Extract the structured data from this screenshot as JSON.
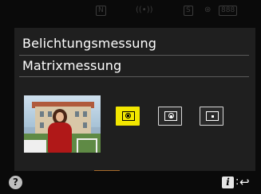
{
  "menu": {
    "title": "Belichtungsmessung",
    "value": "Matrixmessung"
  },
  "metering_modes": [
    {
      "name": "matrix",
      "selected": true
    },
    {
      "name": "center-weighted",
      "selected": false
    },
    {
      "name": "spot",
      "selected": false
    }
  ],
  "status_bar": {
    "item1": "N",
    "item2": "S",
    "item3": "888"
  },
  "footer": {
    "help_label": "?",
    "i_key": "i",
    "separator": ":",
    "back_symbol": "↩"
  },
  "colors": {
    "selected_accent": "#f2e600",
    "panel_bg": "#1f1f1f",
    "screen_bg": "#0a0a0a"
  },
  "icons": [
    "matrix-metering-icon",
    "center-weighted-metering-icon",
    "spot-metering-icon",
    "help-icon",
    "info-key-icon",
    "back-icon"
  ]
}
